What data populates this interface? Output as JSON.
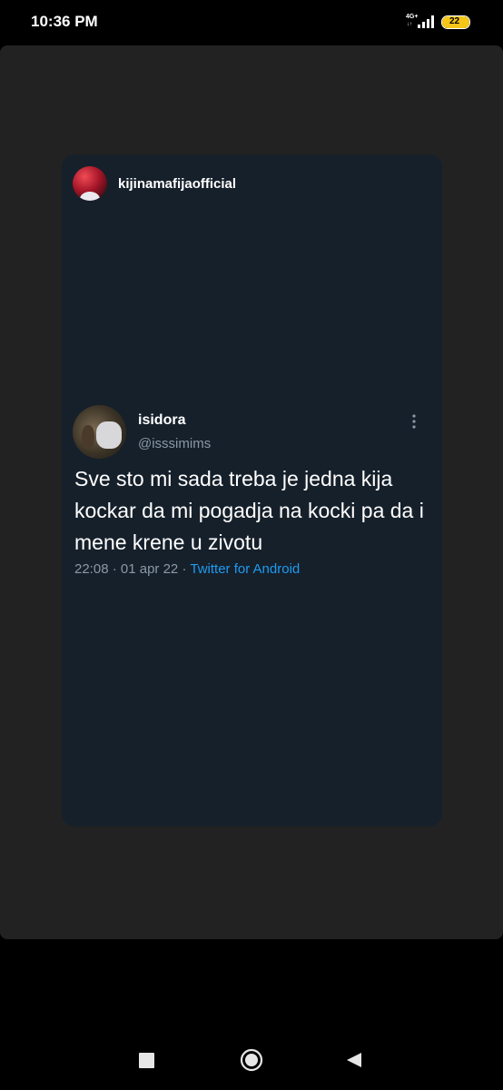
{
  "status_bar": {
    "time": "10:36 PM",
    "network_type": "4G+",
    "network_arrows": "↓↑",
    "signal_icon": "signal-bars-icon",
    "battery_level": "22",
    "battery_color": "#f5c518"
  },
  "story": {
    "username": "kijinamafijaofficial",
    "avatar_icon": "profile-avatar"
  },
  "tweet": {
    "display_name": "isidora",
    "handle": "@isssimims",
    "text": "Sve sto mi sada treba je jedna kija kockar da mi pogadja na kocki pa da i mene krene u zivotu",
    "time": "22:08",
    "separator": "·",
    "date": "01 apr 22",
    "source": "Twitter for Android",
    "source_color": "#1d9bf0",
    "more_icon": "more-vertical-icon"
  },
  "nav_bar": {
    "recents_icon": "square-recents-icon",
    "home_icon": "circle-home-icon",
    "back_icon": "triangle-back-icon"
  },
  "colors": {
    "panel_background": "#222222",
    "card_background": "#16202b",
    "secondary_text": "#8b98a5"
  }
}
